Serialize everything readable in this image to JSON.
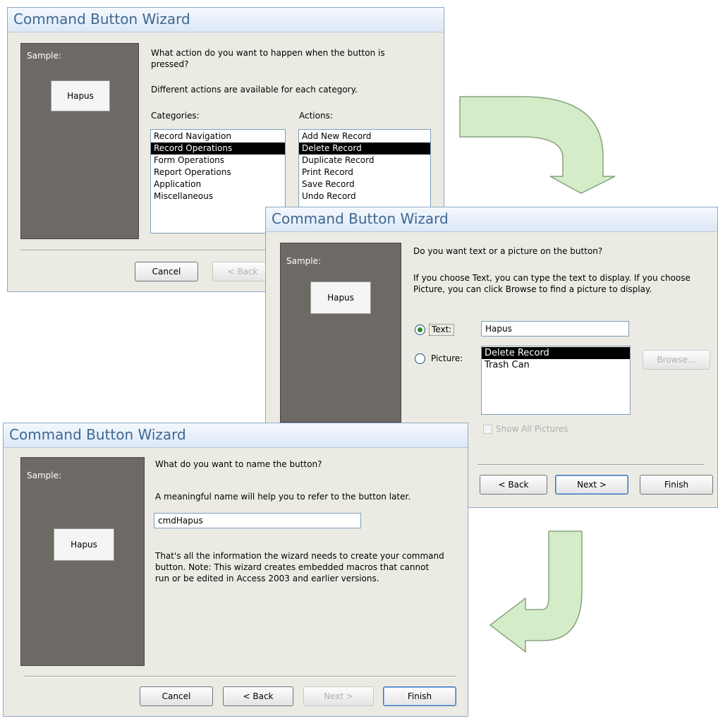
{
  "wizard1": {
    "title": "Command Button Wizard",
    "sample_label": "Sample:",
    "sample_button": "Hapus",
    "question": "What action do you want to happen when the button is pressed?",
    "hint": "Different actions are available for each category.",
    "categories_label": "Categories:",
    "actions_label": "Actions:",
    "categories": [
      "Record Navigation",
      "Record Operations",
      "Form Operations",
      "Report Operations",
      "Application",
      "Miscellaneous"
    ],
    "actions": [
      "Add New Record",
      "Delete Record",
      "Duplicate Record",
      "Print Record",
      "Save Record",
      "Undo Record"
    ],
    "cancel": "Cancel",
    "back": "< Back"
  },
  "wizard2": {
    "title": "Command Button Wizard",
    "sample_label": "Sample:",
    "sample_button": "Hapus",
    "question": "Do you want text or a picture on the button?",
    "hint": "If you choose Text, you can type the text to display.  If you choose Picture, you can click Browse to find a picture to display.",
    "text_label": "Text:",
    "text_value": "Hapus",
    "picture_label": "Picture:",
    "pictures": [
      "Delete Record",
      "Trash Can"
    ],
    "browse": "Browse...",
    "show_all": "Show All Pictures",
    "back": "< Back",
    "next": "Next >",
    "finish": "Finish"
  },
  "wizard3": {
    "title": "Command Button Wizard",
    "sample_label": "Sample:",
    "sample_button": "Hapus",
    "question": "What do you want to name the button?",
    "hint": "A meaningful name will help you to refer to the button later.",
    "name_value": "cmdHapus",
    "info": "That's all the information the wizard needs to create your command button. Note: This wizard creates embedded macros that cannot run or be edited in Access 2003 and earlier versions.",
    "cancel": "Cancel",
    "back": "< Back",
    "next": "Next >",
    "finish": "Finish"
  },
  "colors": {
    "arrow_fill": "#d4ecc8",
    "arrow_stroke": "#8aa281",
    "title_text": "#3d6893",
    "sample_panel": "#6d6a66"
  }
}
